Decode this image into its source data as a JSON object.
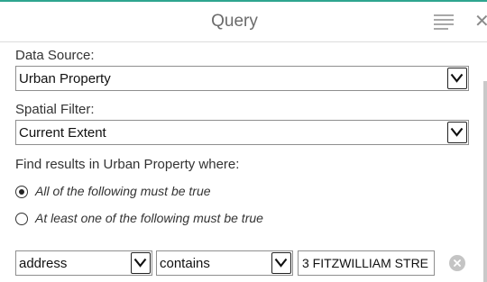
{
  "panel": {
    "title": "Query",
    "menu_icon": "hamburger-menu-icon",
    "close_icon": "close-icon",
    "close_glyph": "✕",
    "accent_color": "#2ea58f"
  },
  "data_source": {
    "label": "Data Source:",
    "value": "Urban Property"
  },
  "spatial_filter": {
    "label": "Spatial Filter:",
    "value": "Current Extent"
  },
  "find_results": {
    "label": "Find results in Urban Property where:",
    "options": [
      {
        "label": "All of the following must be true",
        "selected": true
      },
      {
        "label": "At least one of the following must be true",
        "selected": false
      }
    ]
  },
  "condition": {
    "field": "address",
    "operator": "contains",
    "value": "3 FITZWILLIAM STRE",
    "remove_icon": "remove-circle-icon"
  }
}
